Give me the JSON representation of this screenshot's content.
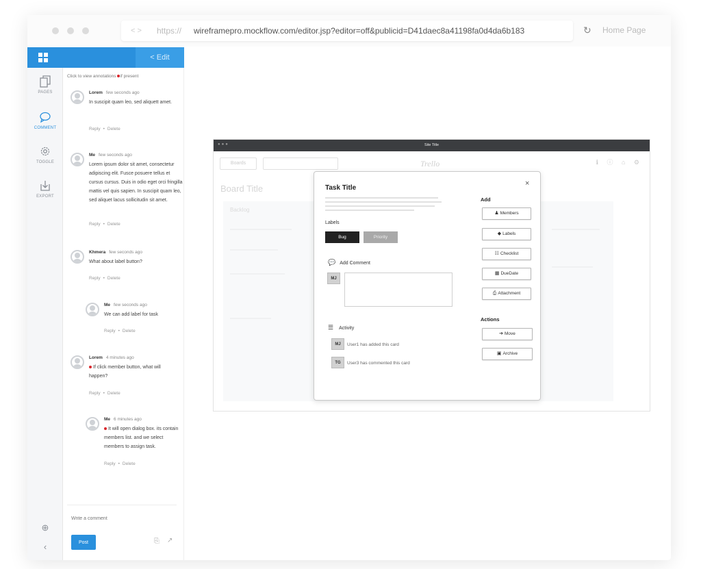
{
  "browser": {
    "url_protocol": "https://",
    "url": "wireframepro.mockflow.com/editor.jsp?editor=off&publicid=D41daec8a41198fa0d4da6b183",
    "home_label": "Home Page"
  },
  "app": {
    "edit_label": "< Edit",
    "accent_color": "#2a90dd",
    "rail": [
      {
        "label": "PAGES",
        "icon": "pages-icon"
      },
      {
        "label": "COMMENT",
        "icon": "comment-icon"
      },
      {
        "label": "TOGGLE",
        "icon": "gear-icon"
      },
      {
        "label": "EXPORT",
        "icon": "export-icon"
      }
    ]
  },
  "comments": {
    "hint_before": "Click to view annotations",
    "hint_after": "if present",
    "reply_label": "Reply",
    "delete_label": "Delete",
    "items": [
      {
        "author": "Lorem",
        "time": "few seconds ago",
        "text": "In suscipit quam leo, sed aliquett amet."
      },
      {
        "author": "Me",
        "time": "few seconds ago",
        "text": "Lorem ipsum dolor sit amet, consectetur adipiscing elit. Fusce posuere tellus et cursus cursus. Duis in odio eget orci fringilla mattis vel quis sapien. In suscipit quam leo, sed aliquet lacus sollicitudin sit amet."
      },
      {
        "author": "Khmera",
        "time": "few seconds ago",
        "text": "What about label button?"
      },
      {
        "author": "Me",
        "time": "few seconds ago",
        "text": "We can add label for task"
      },
      {
        "author": "Lorem",
        "time": "4 minutes ago",
        "text": "If click member button, what will happen?"
      },
      {
        "author": "Me",
        "time": "6 minutes ago",
        "text": "It will open dialog box. its contain members list. and we select members to assign task."
      }
    ],
    "composer_placeholder": "Write a comment",
    "post_label": "Post"
  },
  "wireframe": {
    "window_title": "Site Title",
    "boards_label": "Boards",
    "logo_text": "Trello",
    "board_title": "Board Title",
    "column_name": "Backlog",
    "modal": {
      "title": "Task Title",
      "close": "×",
      "labels_heading": "Labels",
      "labels": [
        "Bug",
        "Priority"
      ],
      "add_comment": "Add Comment",
      "comment_avatar": "MJ",
      "activity_heading": "Activity",
      "activity": [
        {
          "avatar": "MJ",
          "text": "User1 has added this card"
        },
        {
          "avatar": "TG",
          "text": "User3 has commented this card"
        }
      ],
      "add_heading": "Add",
      "add_buttons": [
        "Members",
        "Labels",
        "Checklist",
        "DueDate",
        "Attachment"
      ],
      "actions_heading": "Actions",
      "action_buttons": [
        "Move",
        "Archive"
      ]
    }
  }
}
